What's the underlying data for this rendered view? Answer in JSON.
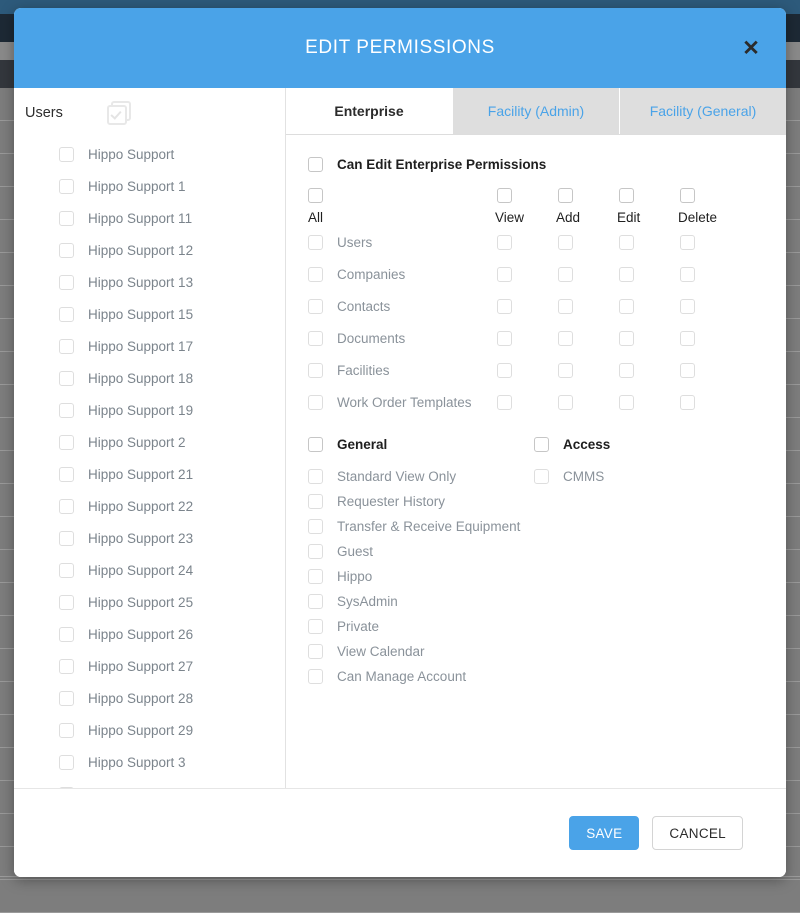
{
  "backdrop": {
    "row_count": 25
  },
  "modal": {
    "title": "EDIT PERMISSIONS",
    "close_icon": "close-icon",
    "header_color": "#4aa3e8"
  },
  "left_pane": {
    "header_label": "Users",
    "select_all_icon": "select-all-checkbox-icon",
    "users": [
      "Hippo Support",
      "Hippo Support 1",
      "Hippo Support 11",
      "Hippo Support 12",
      "Hippo Support 13",
      "Hippo Support 15",
      "Hippo Support 17",
      "Hippo Support 18",
      "Hippo Support 19",
      "Hippo Support 2",
      "Hippo Support 21",
      "Hippo Support 22",
      "Hippo Support 23",
      "Hippo Support 24",
      "Hippo Support 25",
      "Hippo Support 26",
      "Hippo Support 27",
      "Hippo Support 28",
      "Hippo Support 29",
      "Hippo Support 3"
    ]
  },
  "tabs": [
    {
      "label": "Enterprise",
      "active": true
    },
    {
      "label": "Facility (Admin)",
      "active": false
    },
    {
      "label": "Facility (General)",
      "active": false
    }
  ],
  "permissions": {
    "can_edit_label": "Can Edit Enterprise Permissions",
    "columns": [
      "All",
      "View",
      "Add",
      "Edit",
      "Delete"
    ],
    "rows": [
      {
        "name": "Users"
      },
      {
        "name": "Companies"
      },
      {
        "name": "Contacts"
      },
      {
        "name": "Documents"
      },
      {
        "name": "Facilities"
      },
      {
        "name": "Work Order Templates"
      }
    ]
  },
  "general": {
    "header": "General",
    "items": [
      "Standard View Only",
      "Requester History",
      "Transfer & Receive Equipment",
      "Guest",
      "Hippo",
      "SysAdmin",
      "Private",
      "View Calendar",
      "Can Manage Account"
    ]
  },
  "access": {
    "header": "Access",
    "items": [
      "CMMS"
    ]
  },
  "footer": {
    "save_label": "SAVE",
    "cancel_label": "CANCEL"
  }
}
